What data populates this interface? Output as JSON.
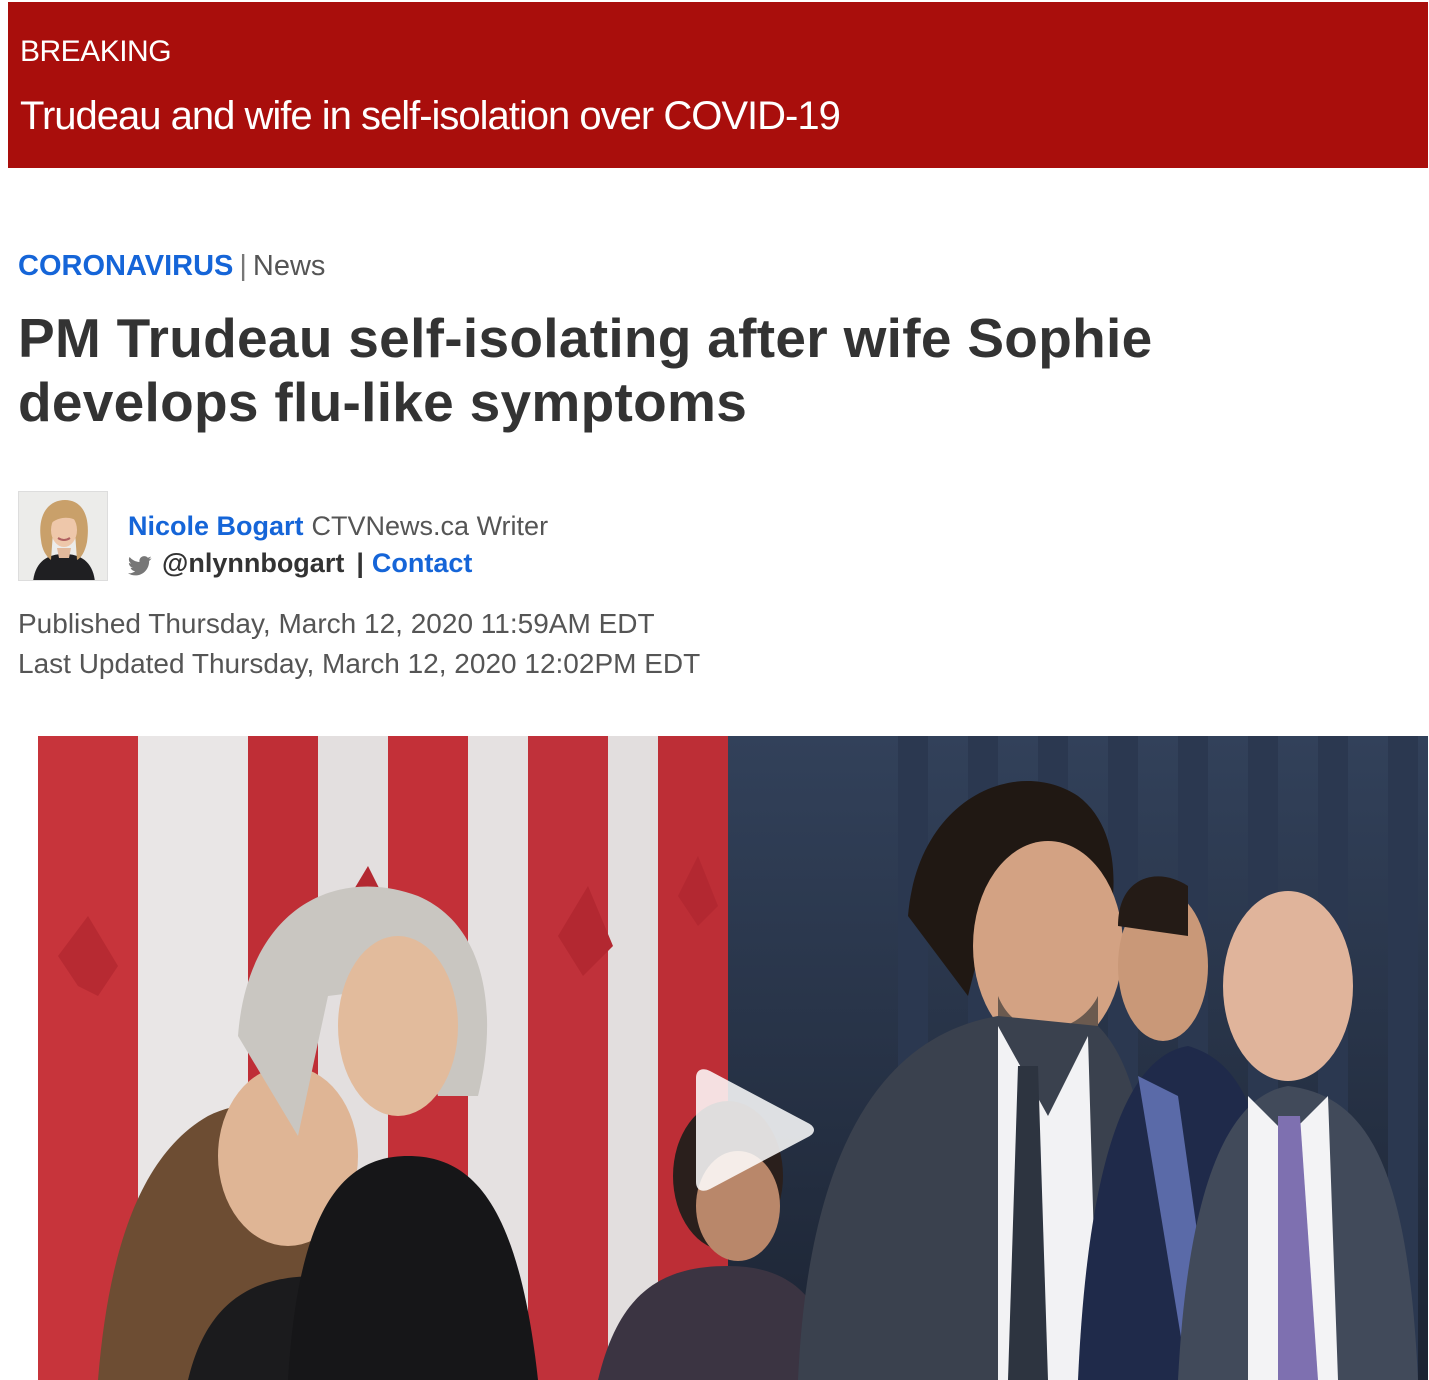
{
  "breaking": {
    "label": "BREAKING",
    "headline": "Trudeau and wife in self-isolation over COVID-19",
    "background_color": "#a90e0c"
  },
  "article": {
    "section": "CORONAVIRUS",
    "separator": "|",
    "type": "News",
    "headline": "PM Trudeau self-isolating after wife Sophie develops flu-like symptoms",
    "accent_color": "#1565d8"
  },
  "author": {
    "name": "Nicole Bogart",
    "role": "CTVNews.ca Writer",
    "twitter_icon": "twitter-icon",
    "twitter_handle": "@nlynnbogart",
    "separator": "|",
    "contact_label": "Contact"
  },
  "dates": {
    "published": "Published Thursday, March 12, 2020 11:59AM EDT",
    "updated": "Last Updated Thursday, March 12, 2020 12:02PM EDT"
  },
  "video": {
    "play_icon": "play-icon"
  }
}
